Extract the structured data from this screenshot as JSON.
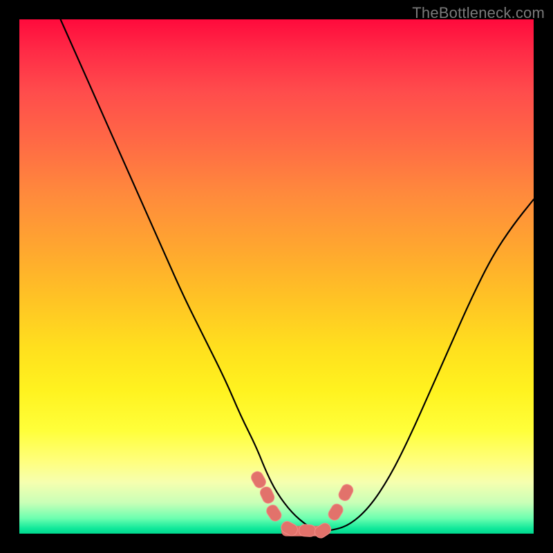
{
  "watermark": "TheBottleneck.com",
  "chart_data": {
    "type": "line",
    "title": "",
    "xlabel": "",
    "ylabel": "",
    "xlim": [
      0,
      100
    ],
    "ylim": [
      0,
      100
    ],
    "grid": false,
    "legend": false,
    "background": "rainbow-vertical-gradient",
    "series": [
      {
        "name": "curve",
        "x": [
          8,
          12,
          16,
          20,
          24,
          28,
          32,
          36,
          40,
          43,
          46,
          48,
          50,
          53,
          56,
          58,
          60,
          64,
          68,
          72,
          76,
          80,
          84,
          88,
          92,
          96,
          100
        ],
        "y": [
          100,
          91,
          82,
          73,
          64,
          55,
          46,
          38,
          30,
          23,
          17,
          12,
          8,
          4,
          1.5,
          0.5,
          0.5,
          1.5,
          5,
          11,
          19,
          28,
          37,
          46,
          54,
          60,
          65
        ]
      }
    ],
    "markers": {
      "name": "highlight-points",
      "shape": "rounded-rect",
      "color": "#e2726b",
      "x": [
        46.5,
        48.2,
        49.5,
        52.5,
        56,
        59,
        61.5,
        63.5
      ],
      "y": [
        10.5,
        7.5,
        4,
        1,
        0.6,
        0.6,
        4.2,
        8
      ]
    }
  }
}
